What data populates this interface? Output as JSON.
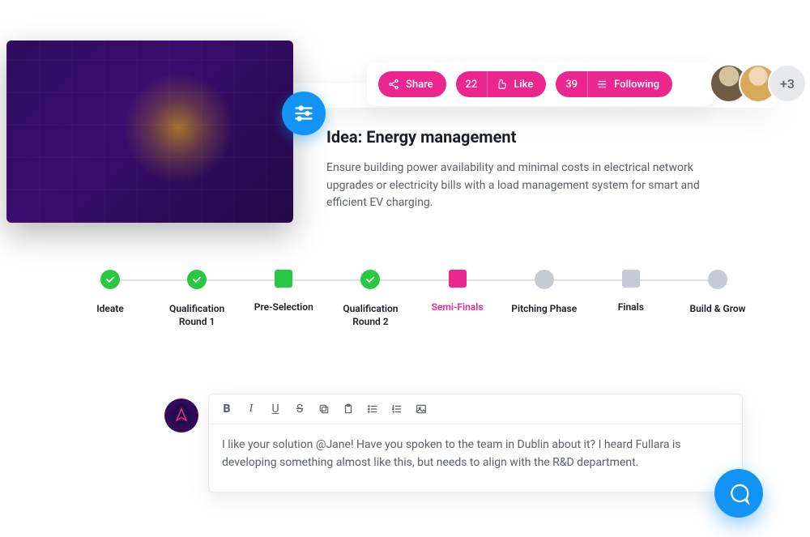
{
  "actions": {
    "share_label": "Share",
    "like_count": "22",
    "like_label": "Like",
    "follow_count": "39",
    "follow_label": "Following"
  },
  "avatars": {
    "overflow": "+3"
  },
  "idea": {
    "title": "Idea: Energy management",
    "description": "Ensure building power availability and minimal costs in electrical network upgrades or electricity bills with a load management system for smart and efficient EV charging."
  },
  "stages": [
    {
      "label": "Ideate",
      "marker": "check"
    },
    {
      "label": "Qualification Round 1",
      "marker": "check"
    },
    {
      "label": "Pre-Selection",
      "marker": "square-green"
    },
    {
      "label": "Qualification Round 2",
      "marker": "check"
    },
    {
      "label": "Semi-Finals",
      "marker": "square-pink",
      "current": true
    },
    {
      "label": "Pitching Phase",
      "marker": "circle-grey"
    },
    {
      "label": "Finals",
      "marker": "square-grey"
    },
    {
      "label": "Build & Grow",
      "marker": "circle-grey"
    }
  ],
  "composer": {
    "text": "I like your solution @Jane! Have you spoken to the team in Dublin about it? I heard Fullara is developing something almost like this, but needs to align with the R&D department."
  },
  "colors": {
    "accent_pink": "#ec268f",
    "accent_blue": "#1294f6",
    "stage_green": "#28c840"
  }
}
